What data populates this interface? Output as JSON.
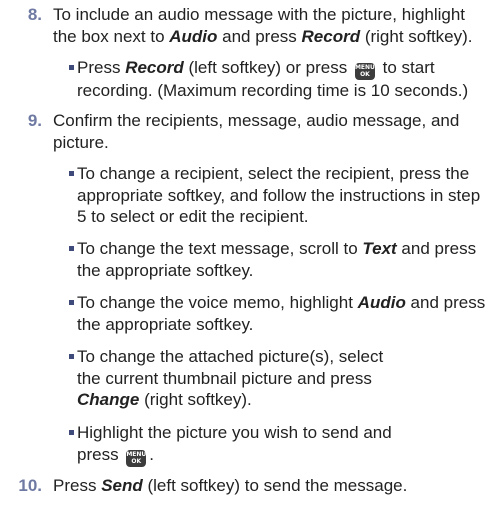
{
  "steps": [
    {
      "number": "8.",
      "text_a": "To include an audio message with the picture, highlight the box next to ",
      "em_a": "Audio",
      "text_b": " and press ",
      "em_b": "Record",
      "text_c": " (right softkey).",
      "subs": [
        {
          "text_a": "Press ",
          "em_a": "Record",
          "text_b": " (left softkey) or press ",
          "key": {
            "line1": "MENU",
            "line2": "OK"
          },
          "text_c": " to start recording. (Maximum recording time is 10 seconds.)"
        }
      ]
    },
    {
      "number": "9.",
      "text": "Confirm the recipients, message, audio message, and picture.",
      "subs": [
        {
          "text": "To change a recipient, select the recipient, press the appropriate softkey, and follow the instructions in step 5 to select or edit the recipient."
        },
        {
          "text_a": "To change the text message, scroll to ",
          "em_a": "Text",
          "text_b": " and press the appropriate softkey."
        },
        {
          "text_a": "To change the voice memo, highlight ",
          "em_a": "Audio",
          "text_b": " and press the appropriate softkey."
        },
        {
          "text_a": "To change the attached picture(s), select the current thumbnail picture and press ",
          "em_a": "Change",
          "text_b": " (right softkey)."
        },
        {
          "text_a": "Highlight the picture you wish to send and press ",
          "key": {
            "line1": "MENU",
            "line2": "OK"
          },
          "text_b": "."
        }
      ]
    },
    {
      "number": "10.",
      "text_a": "Press ",
      "em_a": "Send",
      "text_b": " (left softkey) to send the message."
    }
  ]
}
